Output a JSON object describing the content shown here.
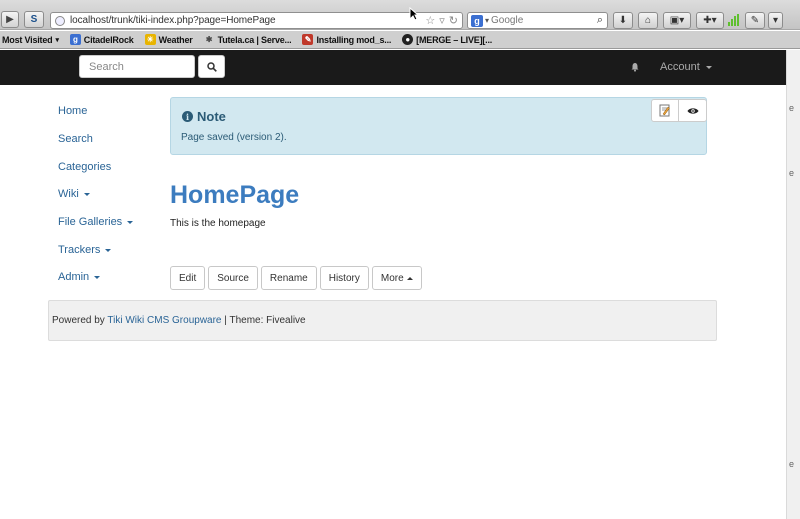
{
  "browser": {
    "url": "localhost/trunk/tiki-index.php?page=HomePage",
    "search_engine": "Google",
    "bookmarks": [
      {
        "label": "Most Visited",
        "icon": "dropdown-icon"
      },
      {
        "label": "CitadelRock",
        "icon": "google-icon"
      },
      {
        "label": "Weather",
        "icon": "weather-icon"
      },
      {
        "label": "Tutela.ca | Serve...",
        "icon": "tutela-icon"
      },
      {
        "label": "Installing mod_s...",
        "icon": "feather-icon"
      },
      {
        "label": "[MERGE – LIVE][...",
        "icon": "github-icon"
      }
    ]
  },
  "navbar": {
    "search_placeholder": "Search",
    "account_label": "Account"
  },
  "sidebar": {
    "items": [
      {
        "label": "Home",
        "dropdown": false
      },
      {
        "label": "Search",
        "dropdown": false
      },
      {
        "label": "Categories",
        "dropdown": false
      },
      {
        "label": "Wiki",
        "dropdown": true
      },
      {
        "label": "File Galleries",
        "dropdown": true
      },
      {
        "label": "Trackers",
        "dropdown": true
      },
      {
        "label": "Admin",
        "dropdown": true
      }
    ]
  },
  "alert": {
    "title": "Note",
    "message": "Page saved (version 2)."
  },
  "page": {
    "title": "HomePage",
    "content": "This is the homepage"
  },
  "actions": {
    "edit": "Edit",
    "source": "Source",
    "rename": "Rename",
    "history": "History",
    "more": "More"
  },
  "footer": {
    "prefix": "Powered by ",
    "link": "Tiki Wiki CMS Groupware",
    "suffix": " | Theme: Fivealive"
  },
  "colors": {
    "navbar_bg": "#1a1a1a",
    "link": "#2a6496",
    "title": "#3c7cbf",
    "alert_bg": "#d2e8f0"
  }
}
